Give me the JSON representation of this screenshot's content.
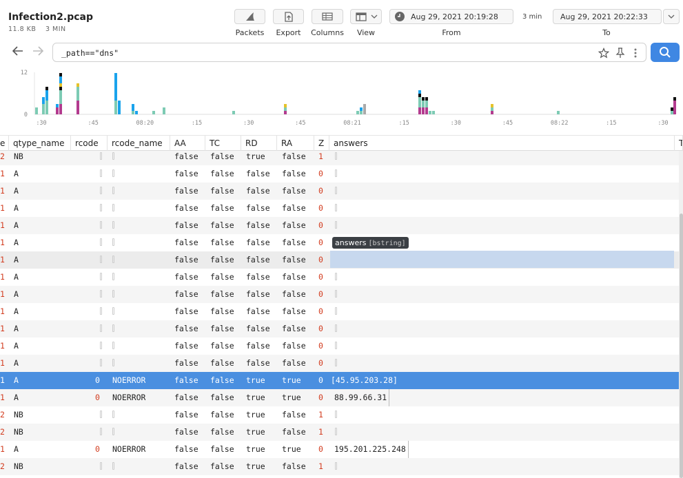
{
  "header": {
    "title": "Infection2.pcap",
    "size": "11.8 KB",
    "duration": "3 MIN",
    "toolbar": {
      "packets_label": "Packets",
      "export_label": "Export",
      "columns_label": "Columns",
      "view_label": "View"
    },
    "time_range": {
      "from_value": "Aug 29, 2021 20:19:28",
      "from_label": "From",
      "span": "3 min",
      "to_value": "Aug 29, 2021 20:22:33",
      "to_label": "To"
    }
  },
  "search": {
    "query": "_path==\"dns\""
  },
  "histogram": {
    "y_ticks": [
      "12",
      "0"
    ],
    "x_ticks": [
      ":30",
      ":45",
      "08:20",
      ":15",
      ":30",
      ":45",
      "08:21",
      ":15",
      ":30",
      ":45",
      "08:22",
      ":15",
      ":30"
    ],
    "colors": [
      "#7dcbb4",
      "#1aa3ec",
      "#b33b8f",
      "#e6c229",
      "#111111",
      "#f0a5c8",
      "#aaaaaa"
    ]
  },
  "table": {
    "columns": [
      {
        "name": "e"
      },
      {
        "name": "qtype_name"
      },
      {
        "name": "rcode"
      },
      {
        "name": "rcode_name"
      },
      {
        "name": "AA"
      },
      {
        "name": "TC"
      },
      {
        "name": "RD"
      },
      {
        "name": "RA"
      },
      {
        "name": "Z"
      },
      {
        "name": "answers"
      },
      {
        "name": "T"
      }
    ],
    "rows": [
      {
        "e": "2",
        "qtype_name": "NB",
        "rcode": "",
        "rcode_name": "",
        "AA": "false",
        "TC": "false",
        "RD": "true",
        "RA": "false",
        "Z": "1",
        "answers": ""
      },
      {
        "e": "1",
        "qtype_name": "A",
        "rcode": "",
        "rcode_name": "",
        "AA": "false",
        "TC": "false",
        "RD": "false",
        "RA": "false",
        "Z": "0",
        "answers": ""
      },
      {
        "e": "1",
        "qtype_name": "A",
        "rcode": "",
        "rcode_name": "",
        "AA": "false",
        "TC": "false",
        "RD": "false",
        "RA": "false",
        "Z": "0",
        "answers": ""
      },
      {
        "e": "1",
        "qtype_name": "A",
        "rcode": "",
        "rcode_name": "",
        "AA": "false",
        "TC": "false",
        "RD": "false",
        "RA": "false",
        "Z": "0",
        "answers": ""
      },
      {
        "e": "1",
        "qtype_name": "A",
        "rcode": "",
        "rcode_name": "",
        "AA": "false",
        "TC": "false",
        "RD": "false",
        "RA": "false",
        "Z": "0",
        "answers": ""
      },
      {
        "e": "1",
        "qtype_name": "A",
        "rcode": "",
        "rcode_name": "",
        "AA": "false",
        "TC": "false",
        "RD": "false",
        "RA": "false",
        "Z": "0",
        "answers": ""
      },
      {
        "e": "1",
        "qtype_name": "A",
        "rcode": "",
        "rcode_name": "",
        "AA": "false",
        "TC": "false",
        "RD": "false",
        "RA": "false",
        "Z": "0",
        "answers": ""
      },
      {
        "e": "1",
        "qtype_name": "A",
        "rcode": "",
        "rcode_name": "",
        "AA": "false",
        "TC": "false",
        "RD": "false",
        "RA": "false",
        "Z": "0",
        "answers": ""
      },
      {
        "e": "1",
        "qtype_name": "A",
        "rcode": "",
        "rcode_name": "",
        "AA": "false",
        "TC": "false",
        "RD": "false",
        "RA": "false",
        "Z": "0",
        "answers": ""
      },
      {
        "e": "1",
        "qtype_name": "A",
        "rcode": "",
        "rcode_name": "",
        "AA": "false",
        "TC": "false",
        "RD": "false",
        "RA": "false",
        "Z": "0",
        "answers": ""
      },
      {
        "e": "1",
        "qtype_name": "A",
        "rcode": "",
        "rcode_name": "",
        "AA": "false",
        "TC": "false",
        "RD": "false",
        "RA": "false",
        "Z": "0",
        "answers": ""
      },
      {
        "e": "1",
        "qtype_name": "A",
        "rcode": "",
        "rcode_name": "",
        "AA": "false",
        "TC": "false",
        "RD": "false",
        "RA": "false",
        "Z": "0",
        "answers": ""
      },
      {
        "e": "1",
        "qtype_name": "A",
        "rcode": "",
        "rcode_name": "",
        "AA": "false",
        "TC": "false",
        "RD": "false",
        "RA": "false",
        "Z": "0",
        "answers": ""
      },
      {
        "e": "1",
        "qtype_name": "A",
        "rcode": "0",
        "rcode_name": "NOERROR",
        "AA": "false",
        "TC": "false",
        "RD": "true",
        "RA": "true",
        "Z": "0",
        "answers": "[45.95.203.28]"
      },
      {
        "e": "1",
        "qtype_name": "A",
        "rcode": "0",
        "rcode_name": "NOERROR",
        "AA": "false",
        "TC": "false",
        "RD": "true",
        "RA": "true",
        "Z": "0",
        "answers": "88.99.66.31"
      },
      {
        "e": "2",
        "qtype_name": "NB",
        "rcode": "",
        "rcode_name": "",
        "AA": "false",
        "TC": "false",
        "RD": "true",
        "RA": "false",
        "Z": "1",
        "answers": ""
      },
      {
        "e": "2",
        "qtype_name": "NB",
        "rcode": "",
        "rcode_name": "",
        "AA": "false",
        "TC": "false",
        "RD": "true",
        "RA": "false",
        "Z": "1",
        "answers": ""
      },
      {
        "e": "1",
        "qtype_name": "A",
        "rcode": "0",
        "rcode_name": "NOERROR",
        "AA": "false",
        "TC": "false",
        "RD": "true",
        "RA": "true",
        "Z": "0",
        "answers": "195.201.225.248"
      },
      {
        "e": "2",
        "qtype_name": "NB",
        "rcode": "",
        "rcode_name": "",
        "AA": "false",
        "TC": "false",
        "RD": "true",
        "RA": "false",
        "Z": "1",
        "answers": ""
      }
    ],
    "selected_row": 13,
    "hover_row": 6
  },
  "tooltip": {
    "field": "answers",
    "type": "[bstring]"
  },
  "colors": {
    "accent": "#3f87e3",
    "selected_row": "#4a8fe0",
    "number_red": "#d23c1f"
  },
  "icons": {
    "packets": "shark-fin-icon",
    "export": "export-icon",
    "columns": "columns-icon",
    "view": "layout-icon",
    "clock": "clock-icon",
    "back": "back-arrow-icon",
    "forward": "forward-arrow-icon",
    "star": "star-icon",
    "pin": "pin-icon",
    "more": "kebab-menu-icon",
    "search": "search-icon"
  }
}
